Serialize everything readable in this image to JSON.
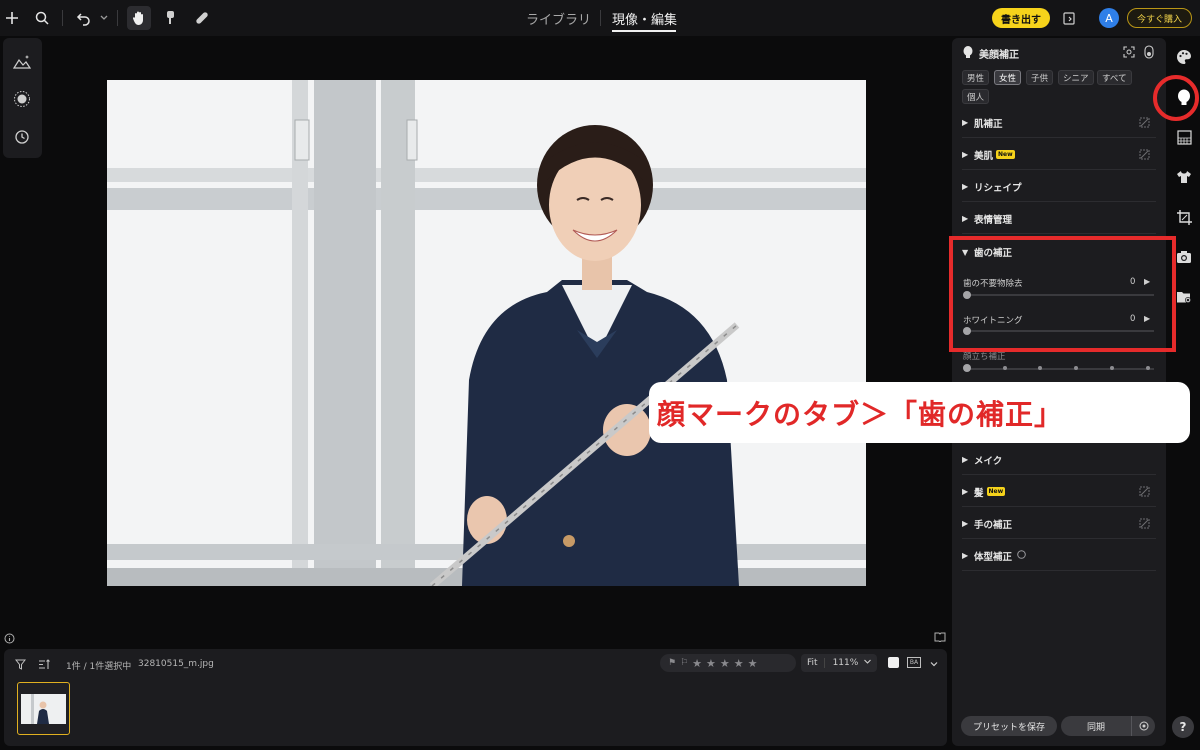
{
  "topbar": {
    "tabs": [
      {
        "label": "ライブラリ",
        "active": false
      },
      {
        "label": "現像・編集",
        "active": true
      }
    ],
    "export_label": "書き出す",
    "avatar_letter": "A",
    "buy_label": "今すぐ購入"
  },
  "filmstrip": {
    "count_text": "1件 / 1件選択中",
    "filename": "32810515_m.jpg",
    "fit_label": "Fit",
    "zoom": "111%"
  },
  "panel": {
    "title": "美顔補正",
    "chips": [
      {
        "label": "男性",
        "selected": false
      },
      {
        "label": "女性",
        "selected": true
      },
      {
        "label": "子供",
        "selected": false
      },
      {
        "label": "シニア",
        "selected": false
      },
      {
        "label": "すべて",
        "selected": false
      },
      {
        "label": "個人",
        "selected": false
      }
    ],
    "sections": [
      {
        "label": "肌補正",
        "new": false
      },
      {
        "label": "美肌",
        "new": true
      },
      {
        "label": "リシェイプ",
        "new": false
      },
      {
        "label": "表情管理",
        "new": false
      }
    ],
    "teeth": {
      "label": "歯の補正",
      "sliders": [
        {
          "label": "歯の不要物除去",
          "value": "0"
        },
        {
          "label": "ホワイトニング",
          "value": "0"
        }
      ]
    },
    "partial_label": "顔立ち補正",
    "lower_sections": [
      {
        "label": "メイク",
        "new": false
      },
      {
        "label": "髪",
        "new": true
      },
      {
        "label": "手の補正",
        "new": false
      },
      {
        "label": "体型補正",
        "new": false
      }
    ],
    "new_badge": "New",
    "preset_label": "プリセットを保存",
    "sync_label": "同期"
  },
  "callout": "顔マークのタブ＞「歯の補正」",
  "colors": {
    "accent_yellow": "#f6d31b",
    "highlight_red": "#e62b2b",
    "avatar_blue": "#2f7fe8"
  }
}
